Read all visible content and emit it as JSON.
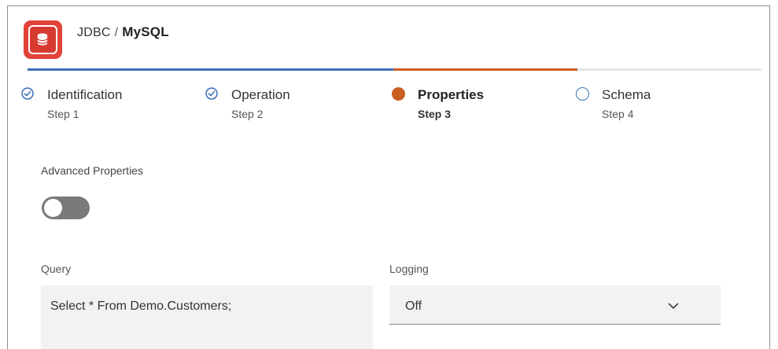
{
  "header": {
    "crumb_parent": "JDBC",
    "crumb_separator": "/",
    "crumb_current": "MySQL",
    "logo_icon": "database-icon",
    "brand_color": "#e2423a"
  },
  "progress": {
    "completed_color": "#3b70b6",
    "active_color": "#c95d22",
    "track_color": "#e6e6e6"
  },
  "steps": [
    {
      "label": "Identification",
      "sub": "Step 1",
      "state": "done",
      "icon": "check-circle-icon"
    },
    {
      "label": "Operation",
      "sub": "Step 2",
      "state": "done",
      "icon": "check-circle-icon"
    },
    {
      "label": "Properties",
      "sub": "Step 3",
      "state": "active",
      "icon": "filled-dot-icon"
    },
    {
      "label": "Schema",
      "sub": "Step 4",
      "state": "pending",
      "icon": "empty-circle-icon"
    }
  ],
  "form": {
    "advanced_label": "Advanced Properties",
    "advanced_enabled": false,
    "query_label": "Query",
    "query_value": "Select * From Demo.Customers;",
    "logging_label": "Logging",
    "logging_value": "Off"
  }
}
